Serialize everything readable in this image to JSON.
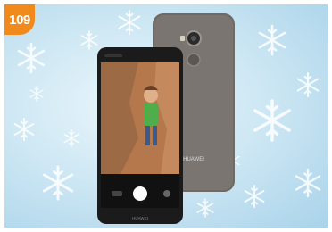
{
  "badge": {
    "number": "109",
    "color": "#f08a1c"
  },
  "phone": {
    "brand_back": "HUAWEI",
    "brand_front": "HUAWEI",
    "camera_modes": [
      "",
      "",
      "",
      "",
      ""
    ],
    "body_color": "#6f6a66"
  },
  "background": {
    "theme": "snowflakes",
    "color": "#bfe0f0"
  },
  "icons": [
    "snowflake-icon",
    "shutter-button-icon",
    "camera-lens-icon",
    "fingerprint-sensor-icon"
  ]
}
